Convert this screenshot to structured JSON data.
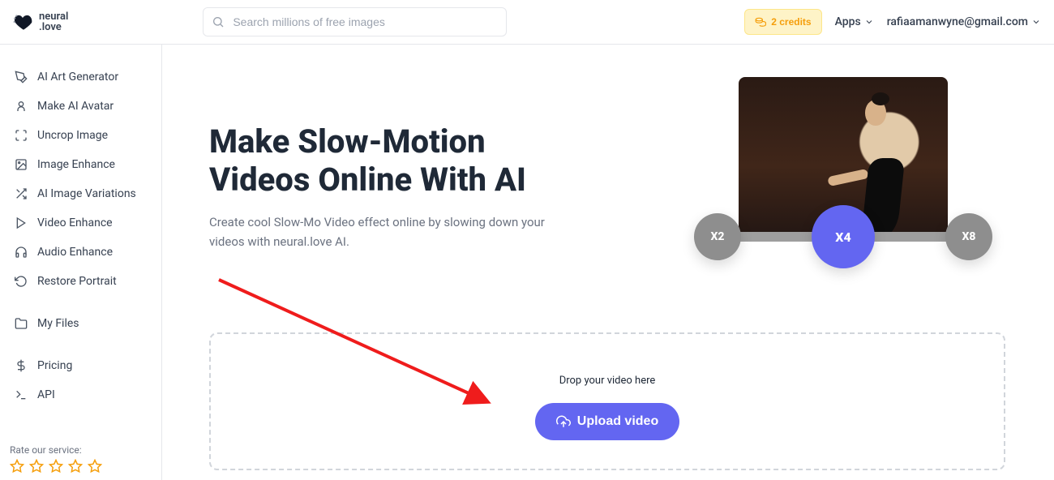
{
  "brand": {
    "name": "neural\n.love"
  },
  "header": {
    "search_placeholder": "Search millions of free images",
    "credits_label": "2 credits",
    "apps_label": "Apps",
    "user_email": "rafiaamanwyne@gmail.com"
  },
  "sidebar": {
    "items": [
      {
        "icon": "pen-icon",
        "label": "AI Art Generator"
      },
      {
        "icon": "avatar-icon",
        "label": "Make AI Avatar"
      },
      {
        "icon": "uncrop-icon",
        "label": "Uncrop Image"
      },
      {
        "icon": "enhance-image-icon",
        "label": "Image Enhance"
      },
      {
        "icon": "variations-icon",
        "label": "AI Image Variations"
      },
      {
        "icon": "play-icon",
        "label": "Video Enhance"
      },
      {
        "icon": "headphones-icon",
        "label": "Audio Enhance"
      },
      {
        "icon": "restore-icon",
        "label": "Restore Portrait"
      }
    ],
    "secondary": [
      {
        "icon": "folder-icon",
        "label": "My Files"
      }
    ],
    "tertiary": [
      {
        "icon": "dollar-icon",
        "label": "Pricing"
      },
      {
        "icon": "terminal-icon",
        "label": "API"
      }
    ],
    "rate_label": "Rate our service:"
  },
  "hero": {
    "title": "Make Slow-Motion Videos Online With AI",
    "subtitle": "Create cool Slow-Mo Video effect online by slowing down your videos with neural.love AI."
  },
  "speeds": {
    "options": [
      "X2",
      "X4",
      "X8"
    ],
    "active_index": 1
  },
  "dropzone": {
    "hint": "Drop your video here",
    "button": "Upload video"
  }
}
